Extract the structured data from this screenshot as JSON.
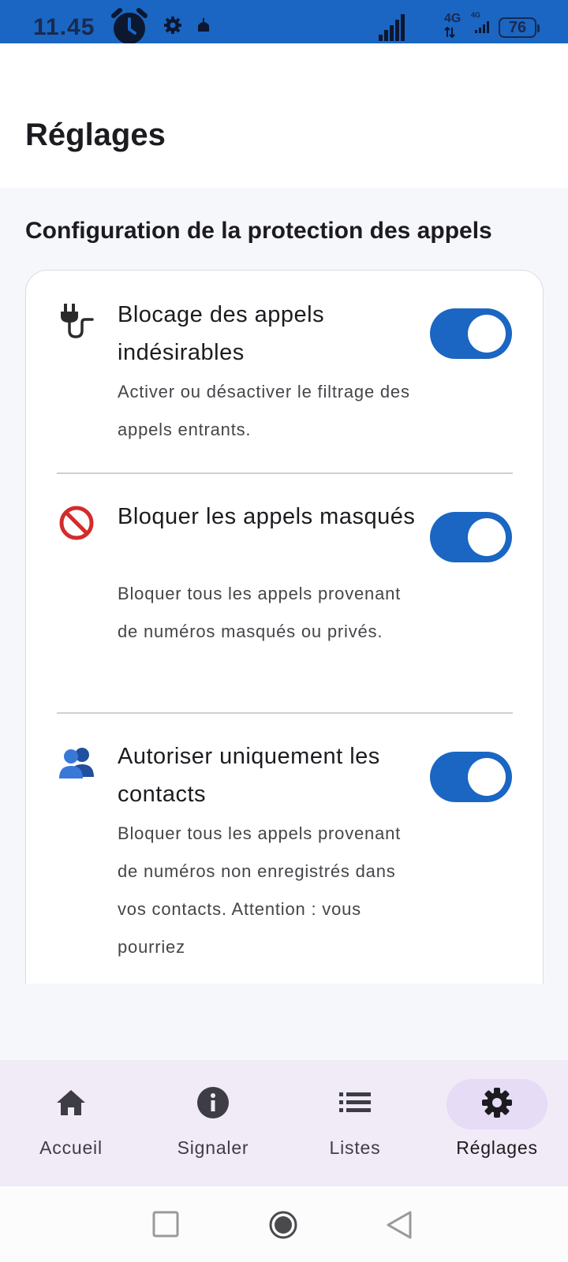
{
  "status_bar": {
    "time": "11.45",
    "network": "4G",
    "network_secondary": "4G",
    "battery": "76"
  },
  "header": {
    "title": "Réglages"
  },
  "section": {
    "title": "Configuration de la protection des appels"
  },
  "settings": [
    {
      "icon": "plug-icon",
      "title": "Blocage des appels indésirables",
      "description": "Activer ou désactiver le filtrage des appels entrants.",
      "enabled": true
    },
    {
      "icon": "prohibited-icon",
      "title": "Bloquer les appels masqués",
      "description": "Bloquer tous les appels provenant de numéros masqués ou privés.",
      "enabled": true
    },
    {
      "icon": "contacts-icon",
      "title": "Autoriser uniquement les contacts",
      "description": "Bloquer tous les appels provenant de numéros non enregistrés dans vos contacts. Attention : vous pourriez",
      "enabled": true
    }
  ],
  "bottom_nav": {
    "items": [
      {
        "label": "Accueil",
        "icon": "home-icon",
        "active": false
      },
      {
        "label": "Signaler",
        "icon": "info-icon",
        "active": false
      },
      {
        "label": "Listes",
        "icon": "list-icon",
        "active": false
      },
      {
        "label": "Réglages",
        "icon": "settings-icon",
        "active": true
      }
    ]
  },
  "colors": {
    "accent": "#1a66c2",
    "nav_background": "#f0ebf6",
    "nav_active_pill": "#e6dcf6"
  }
}
